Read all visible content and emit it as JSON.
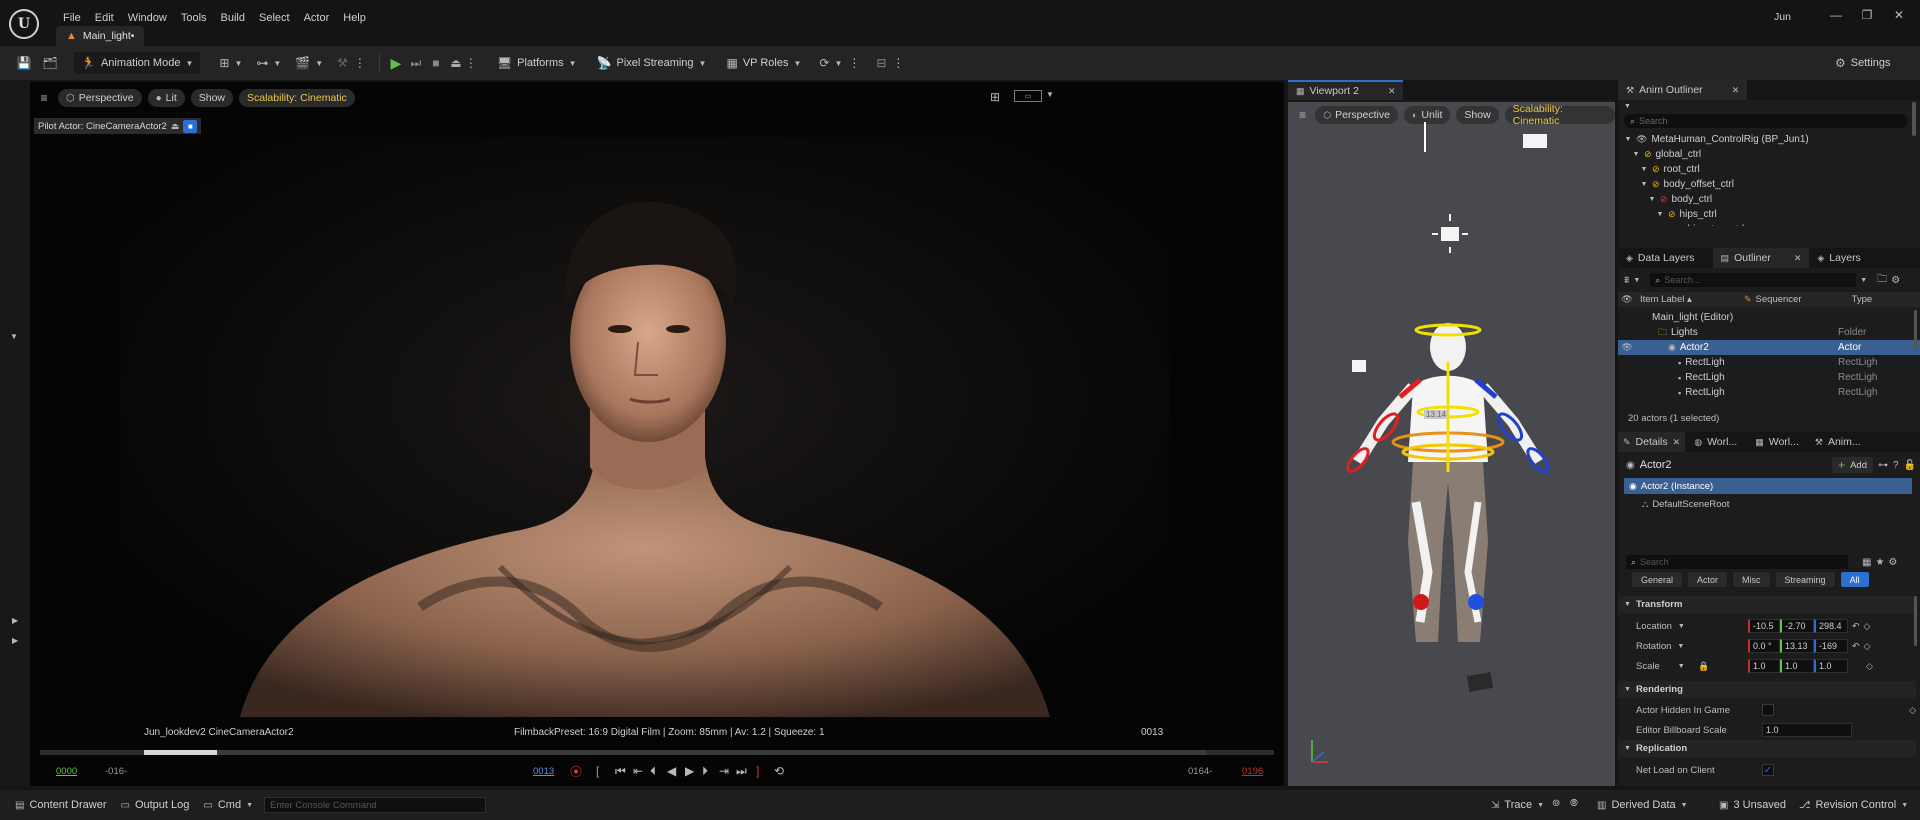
{
  "menu": {
    "items": [
      "File",
      "Edit",
      "Window",
      "Tools",
      "Build",
      "Select",
      "Actor",
      "Help"
    ],
    "user": "Jun"
  },
  "doc_tab": {
    "label": "Main_light•"
  },
  "toolbar": {
    "mode": "Animation Mode",
    "platforms": "Platforms",
    "pixel_streaming": "Pixel Streaming",
    "vp_roles": "VP Roles",
    "settings": "Settings"
  },
  "viewport1": {
    "perspective": "Perspective",
    "lit": "Lit",
    "show": "Show",
    "scalability": "Scalability: Cinematic",
    "pilot": "Pilot Actor: CineCameraActor2",
    "camera_label": "Jun_lookdev2  CineCameraActor2",
    "filmback": "FilmbackPreset: 16:9 Digital Film | Zoom: 85mm | Av: 1.2 | Squeeze: 1",
    "frame_right": "0013",
    "timeline": {
      "start": "0000",
      "in": "-016-",
      "current": "0013",
      "out": "0164-",
      "end": "0196",
      "progress": 0.16
    }
  },
  "viewport2": {
    "tab": "Viewport 2",
    "perspective": "Perspective",
    "unlit": "Unlit",
    "show": "Show",
    "scalability": "Scalability: Cinematic",
    "overlay_label": "13.14"
  },
  "anim_outliner": {
    "tab": "Anim Outliner",
    "search_placeholder": "Search",
    "items": [
      {
        "label": "MetaHuman_ControlRig  (BP_Jun1)",
        "depth": 0
      },
      {
        "label": "global_ctrl",
        "depth": 1
      },
      {
        "label": "root_ctrl",
        "depth": 2
      },
      {
        "label": "body_offset_ctrl",
        "depth": 2
      },
      {
        "label": "body_ctrl",
        "depth": 3
      },
      {
        "label": "hips_ctrl",
        "depth": 4
      },
      {
        "label": "hips_tan_ctrl",
        "depth": 5
      }
    ]
  },
  "outliner": {
    "tabs": [
      "Data Layers",
      "Outliner",
      "Layers"
    ],
    "search_placeholder": "Search...",
    "columns": [
      "Item Label ▴",
      "Sequencer",
      "Type"
    ],
    "rows": [
      {
        "label": "Main_light (Editor)",
        "type": "",
        "depth": 0,
        "selected": false
      },
      {
        "label": "Lights",
        "type": "Folder",
        "depth": 1,
        "selected": false
      },
      {
        "label": "Actor2",
        "type": "Actor",
        "depth": 2,
        "selected": true
      },
      {
        "label": "RectLigh",
        "type": "RectLigh",
        "depth": 3,
        "selected": false
      },
      {
        "label": "RectLigh",
        "type": "RectLigh",
        "depth": 3,
        "selected": false
      },
      {
        "label": "RectLigh",
        "type": "RectLigh",
        "depth": 3,
        "selected": false
      }
    ],
    "status": "20 actors (1 selected)"
  },
  "details": {
    "tabs": [
      "Details",
      "Worl...",
      "Worl...",
      "Anim..."
    ],
    "actor_name": "Actor2",
    "add": "Add",
    "components": [
      "Actor2 (Instance)",
      "DefaultSceneRoot"
    ],
    "search_placeholder": "Search",
    "categories": [
      "General",
      "Actor",
      "Misc",
      "Streaming",
      "All"
    ],
    "transform_header": "Transform",
    "location": {
      "label": "Location",
      "x": "-10.5",
      "y": "-2.70",
      "z": "298.4"
    },
    "rotation": {
      "label": "Rotation",
      "x": "0.0 °",
      "y": "13.13",
      "z": "-169"
    },
    "scale": {
      "label": "Scale",
      "x": "1.0",
      "y": "1.0",
      "z": "1.0"
    },
    "rendering_header": "Rendering",
    "hidden_in_game": "Actor Hidden In Game",
    "billboard_scale": "Editor Billboard Scale",
    "billboard_value": "1.0",
    "replication_header": "Replication",
    "net_load": "Net Load on Client"
  },
  "statusbar": {
    "content_drawer": "Content Drawer",
    "output_log": "Output Log",
    "cmd": "Cmd",
    "console_placeholder": "Enter Console Command",
    "trace": "Trace",
    "derived_data": "Derived Data",
    "unsaved": "3 Unsaved",
    "revision": "Revision Control"
  },
  "colors": {
    "accent": "#2a6fd1",
    "scalability": "#e8c74a",
    "play": "#5fc24a",
    "selection": "#3a5f93"
  }
}
